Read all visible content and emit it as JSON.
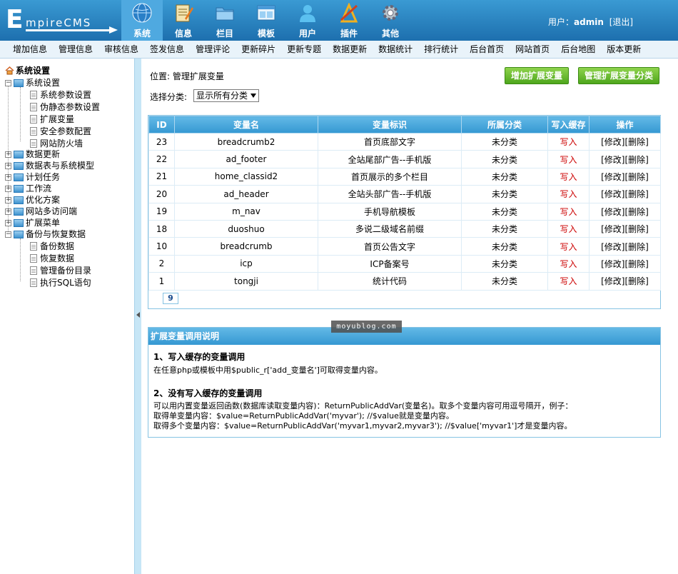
{
  "logo": {
    "big": "E",
    "rest": "mpireCMS"
  },
  "topnav": [
    {
      "label": "系统",
      "icon": "globe-icon",
      "active": true
    },
    {
      "label": "信息",
      "icon": "notepad-icon"
    },
    {
      "label": "栏目",
      "icon": "folder-icon"
    },
    {
      "label": "模板",
      "icon": "window-icon"
    },
    {
      "label": "用户",
      "icon": "user-icon"
    },
    {
      "label": "插件",
      "icon": "tools-icon"
    },
    {
      "label": "其他",
      "icon": "gear-icon"
    }
  ],
  "user": {
    "prefix": "用户：",
    "name": "admin",
    "logout": "[退出]"
  },
  "menubar": [
    "增加信息",
    "管理信息",
    "审核信息",
    "签发信息",
    "管理评论",
    "更新碎片",
    "更新专题",
    "数据更新",
    "数据统计",
    "排行统计",
    "后台首页",
    "网站首页",
    "后台地图",
    "版本更新"
  ],
  "tree": {
    "root": "系统设置",
    "nodes": [
      {
        "label": "系统设置",
        "open": true,
        "children": [
          "系统参数设置",
          "伪静态参数设置",
          "扩展变量",
          "安全参数配置",
          "网站防火墙"
        ]
      },
      {
        "label": "数据更新"
      },
      {
        "label": "数据表与系统模型"
      },
      {
        "label": "计划任务"
      },
      {
        "label": "工作流"
      },
      {
        "label": "优化方案"
      },
      {
        "label": "网站多访问端"
      },
      {
        "label": "扩展菜单"
      },
      {
        "label": "备份与恢复数据",
        "open": true,
        "children": [
          "备份数据",
          "恢复数据",
          "管理备份目录",
          "执行SQL语句"
        ]
      }
    ]
  },
  "location": {
    "prefix": "位置: ",
    "link": "管理扩展变量"
  },
  "buttons": {
    "add": "增加扩展变量",
    "manage_class": "管理扩展变量分类"
  },
  "filter": {
    "label": "选择分类:",
    "selected": "显示所有分类"
  },
  "table": {
    "headers": [
      "ID",
      "变量名",
      "变量标识",
      "所属分类",
      "写入缓存",
      "操作"
    ],
    "rows": [
      {
        "id": "23",
        "name": "breadcrumb2",
        "title": "首页底部文字",
        "class": "未分类",
        "cache": "写入",
        "edit": "[修改]",
        "del": "[删除]"
      },
      {
        "id": "22",
        "name": "ad_footer",
        "title": "全站尾部广告--手机版",
        "class": "未分类",
        "cache": "写入",
        "edit": "[修改]",
        "del": "[删除]"
      },
      {
        "id": "21",
        "name": "home_classid2",
        "title": "首页展示的多个栏目",
        "class": "未分类",
        "cache": "写入",
        "edit": "[修改]",
        "del": "[删除]"
      },
      {
        "id": "20",
        "name": "ad_header",
        "title": "全站头部广告--手机版",
        "class": "未分类",
        "cache": "写入",
        "edit": "[修改]",
        "del": "[删除]"
      },
      {
        "id": "19",
        "name": "m_nav",
        "title": "手机导航模板",
        "class": "未分类",
        "cache": "写入",
        "edit": "[修改]",
        "del": "[删除]"
      },
      {
        "id": "18",
        "name": "duoshuo",
        "title": "多说二级域名前缀",
        "class": "未分类",
        "cache": "写入",
        "edit": "[修改]",
        "del": "[删除]"
      },
      {
        "id": "10",
        "name": "breadcrumb",
        "title": "首页公告文字",
        "class": "未分类",
        "cache": "写入",
        "edit": "[修改]",
        "del": "[删除]"
      },
      {
        "id": "2",
        "name": "icp",
        "title": "ICP备案号",
        "class": "未分类",
        "cache": "写入",
        "edit": "[修改]",
        "del": "[删除]"
      },
      {
        "id": "1",
        "name": "tongji",
        "title": "统计代码",
        "class": "未分类",
        "cache": "写入",
        "edit": "[修改]",
        "del": "[删除]"
      }
    ],
    "pager": "9"
  },
  "info": {
    "header": "扩展变量调用说明",
    "h1": "1、写入缓存的变量调用",
    "p1": "在任意php或模板中用$public_r['add_变量名']可取得变量内容。",
    "h2": "2、没有写入缓存的变量调用",
    "p2a": "可以用内置变量返回函数(数据库读取变量内容)：ReturnPublicAddVar(变量名)。取多个变量内容可用逗号隔开，例子：",
    "p2b": "取得单变量内容：$value=ReturnPublicAddVar('myvar'); //$value就是变量内容。",
    "p2c": "取得多个变量内容：$value=ReturnPublicAddVar('myvar1,myvar2,myvar3'); //$value['myvar1']才是变量内容。"
  },
  "watermark": "moyublog.com"
}
